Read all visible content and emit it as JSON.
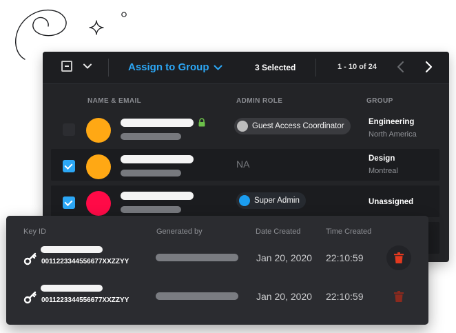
{
  "toolbar": {
    "assign_label": "Assign to Group",
    "selected_label": "3 Selected",
    "page_range": "1 - 10 of 24"
  },
  "columns": {
    "name_email": "NAME & EMAIL",
    "admin_role": "ADMIN ROLE",
    "group": "GROUP"
  },
  "rows": [
    {
      "checked": false,
      "avatar_color": "#ffa814",
      "locked": true,
      "role": "Guest Access Coordinator",
      "role_color": "#bdbdbd",
      "group": "Engineering",
      "region": "North America"
    },
    {
      "checked": true,
      "avatar_color": "#ffa814",
      "locked": false,
      "role": "NA",
      "role_color": "",
      "group": "Design",
      "region": "Montreal"
    },
    {
      "checked": true,
      "avatar_color": "#ff0a47",
      "locked": false,
      "role": "Super Admin",
      "role_color": "#1b9df0",
      "group": "Unassigned",
      "region": ""
    }
  ],
  "keys_table": {
    "headers": {
      "key_id": "Key ID",
      "generated_by": "Generated by",
      "date_created": "Date Created",
      "time_created": "Time Created"
    },
    "rows": [
      {
        "key_id": "0011223344556677XXZZYY",
        "date": "Jan 20, 2020",
        "time": "22:10:59",
        "trash_color": "#e2391f"
      },
      {
        "key_id": "0011223344556677XXZZYY",
        "date": "Jan 20, 2020",
        "time": "22:10:59",
        "trash_color": "#8b2a1e"
      }
    ]
  },
  "colors": {
    "accent": "#2ca7f5",
    "lock": "#6cc04a"
  }
}
